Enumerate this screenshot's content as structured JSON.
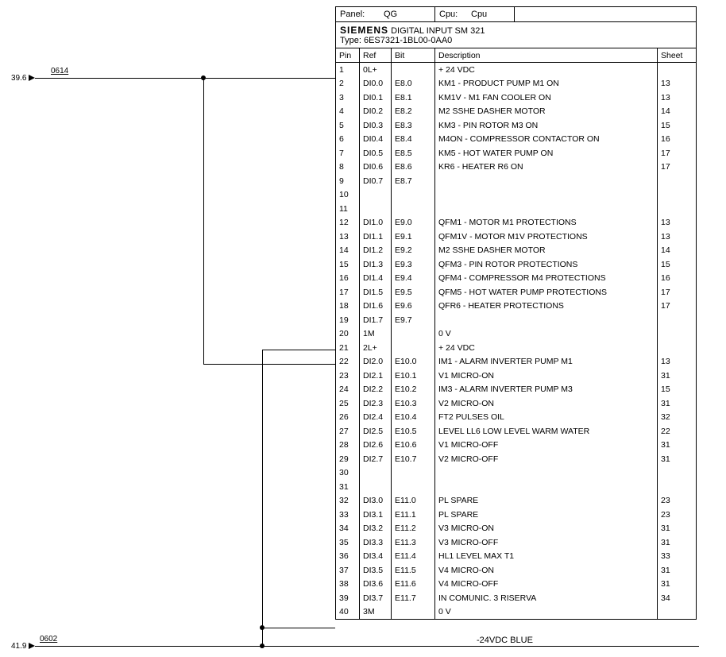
{
  "header": {
    "panel_label": "Panel:",
    "panel_value": "QG",
    "cpu_label": "Cpu:",
    "cpu_value": "Cpu",
    "brand": "SIEMENS",
    "title": "DIGITAL INPUT SM 321",
    "type_label": "Type:",
    "type_value": "6ES7321-1BL00-0AA0"
  },
  "columns": {
    "pin": "Pin",
    "ref": "Ref",
    "bit": "Bit",
    "description": "Description",
    "sheet": "Sheet"
  },
  "rows": [
    {
      "pin": "1",
      "ref": "0L+",
      "bit": "",
      "desc": "+ 24 VDC",
      "sheet": ""
    },
    {
      "pin": "2",
      "ref": "DI0.0",
      "bit": "E8.0",
      "desc": "KM1 - PRODUCT PUMP M1 ON",
      "sheet": "13"
    },
    {
      "pin": "3",
      "ref": "DI0.1",
      "bit": "E8.1",
      "desc": "KM1V - M1 FAN COOLER ON",
      "sheet": "13"
    },
    {
      "pin": "4",
      "ref": "DI0.2",
      "bit": "E8.2",
      "desc": "M2 SSHE DASHER MOTOR",
      "sheet": "14"
    },
    {
      "pin": "5",
      "ref": "DI0.3",
      "bit": "E8.3",
      "desc": "KM3 - PIN ROTOR M3 ON",
      "sheet": "15"
    },
    {
      "pin": "6",
      "ref": "DI0.4",
      "bit": "E8.4",
      "desc": "M4ON - COMPRESSOR CONTACTOR ON",
      "sheet": "16"
    },
    {
      "pin": "7",
      "ref": "DI0.5",
      "bit": "E8.5",
      "desc": "KM5 - HOT WATER PUMP ON",
      "sheet": "17"
    },
    {
      "pin": "8",
      "ref": "DI0.6",
      "bit": "E8.6",
      "desc": "KR6 - HEATER R6 ON",
      "sheet": "17"
    },
    {
      "pin": "9",
      "ref": "DI0.7",
      "bit": "E8.7",
      "desc": "",
      "sheet": ""
    },
    {
      "pin": "10",
      "ref": "",
      "bit": "",
      "desc": "",
      "sheet": ""
    },
    {
      "pin": "11",
      "ref": "",
      "bit": "",
      "desc": "",
      "sheet": ""
    },
    {
      "pin": "12",
      "ref": "DI1.0",
      "bit": "E9.0",
      "desc": "QFM1 - MOTOR M1 PROTECTIONS",
      "sheet": "13"
    },
    {
      "pin": "13",
      "ref": "DI1.1",
      "bit": "E9.1",
      "desc": "QFM1V - MOTOR M1V PROTECTIONS",
      "sheet": "13"
    },
    {
      "pin": "14",
      "ref": "DI1.2",
      "bit": "E9.2",
      "desc": "M2 SSHE DASHER MOTOR",
      "sheet": "14"
    },
    {
      "pin": "15",
      "ref": "DI1.3",
      "bit": "E9.3",
      "desc": "QFM3 - PIN ROTOR PROTECTIONS",
      "sheet": "15"
    },
    {
      "pin": "16",
      "ref": "DI1.4",
      "bit": "E9.4",
      "desc": "QFM4 - COMPRESSOR M4 PROTECTIONS",
      "sheet": "16"
    },
    {
      "pin": "17",
      "ref": "DI1.5",
      "bit": "E9.5",
      "desc": "QFM5 - HOT WATER PUMP PROTECTIONS",
      "sheet": "17"
    },
    {
      "pin": "18",
      "ref": "DI1.6",
      "bit": "E9.6",
      "desc": "QFR6 - HEATER PROTECTIONS",
      "sheet": "17"
    },
    {
      "pin": "19",
      "ref": "DI1.7",
      "bit": "E9.7",
      "desc": "",
      "sheet": ""
    },
    {
      "pin": "20",
      "ref": "1M",
      "bit": "",
      "desc": "0 V",
      "sheet": ""
    },
    {
      "pin": "21",
      "ref": "2L+",
      "bit": "",
      "desc": "+ 24 VDC",
      "sheet": ""
    },
    {
      "pin": "22",
      "ref": "DI2.0",
      "bit": "E10.0",
      "desc": "IM1 - ALARM INVERTER PUMP M1",
      "sheet": "13"
    },
    {
      "pin": "23",
      "ref": "DI2.1",
      "bit": "E10.1",
      "desc": "V1 MICRO-ON",
      "sheet": "31"
    },
    {
      "pin": "24",
      "ref": "DI2.2",
      "bit": "E10.2",
      "desc": "IM3 - ALARM INVERTER PUMP M3",
      "sheet": "15"
    },
    {
      "pin": "25",
      "ref": "DI2.3",
      "bit": "E10.3",
      "desc": "V2 MICRO-ON",
      "sheet": "31"
    },
    {
      "pin": "26",
      "ref": "DI2.4",
      "bit": "E10.4",
      "desc": "FT2 PULSES OIL",
      "sheet": "32"
    },
    {
      "pin": "27",
      "ref": "DI2.5",
      "bit": "E10.5",
      "desc": "LEVEL LL6 LOW LEVEL WARM WATER",
      "sheet": "22"
    },
    {
      "pin": "28",
      "ref": "DI2.6",
      "bit": "E10.6",
      "desc": "V1 MICRO-OFF",
      "sheet": "31"
    },
    {
      "pin": "29",
      "ref": "DI2.7",
      "bit": "E10.7",
      "desc": "V2 MICRO-OFF",
      "sheet": "31"
    },
    {
      "pin": "30",
      "ref": "",
      "bit": "",
      "desc": "",
      "sheet": ""
    },
    {
      "pin": "31",
      "ref": "",
      "bit": "",
      "desc": "",
      "sheet": ""
    },
    {
      "pin": "32",
      "ref": "DI3.0",
      "bit": "E11.0",
      "desc": "PL SPARE",
      "sheet": "23"
    },
    {
      "pin": "33",
      "ref": "DI3.1",
      "bit": "E11.1",
      "desc": "PL SPARE",
      "sheet": "23"
    },
    {
      "pin": "34",
      "ref": "DI3.2",
      "bit": "E11.2",
      "desc": "V3 MICRO-ON",
      "sheet": "31"
    },
    {
      "pin": "35",
      "ref": "DI3.3",
      "bit": "E11.3",
      "desc": "V3 MICRO-OFF",
      "sheet": "31"
    },
    {
      "pin": "36",
      "ref": "DI3.4",
      "bit": "E11.4",
      "desc": "HL1 LEVEL MAX T1",
      "sheet": "33"
    },
    {
      "pin": "37",
      "ref": "DI3.5",
      "bit": "E11.5",
      "desc": "V4 MICRO-ON",
      "sheet": "31"
    },
    {
      "pin": "38",
      "ref": "DI3.6",
      "bit": "E11.6",
      "desc": "V4 MICRO-OFF",
      "sheet": "31"
    },
    {
      "pin": "39",
      "ref": "DI3.7",
      "bit": "E11.7",
      "desc": "IN COMUNIC. 3 RISERVA",
      "sheet": "34"
    },
    {
      "pin": "40",
      "ref": "3M",
      "bit": "",
      "desc": "0 V",
      "sheet": ""
    }
  ],
  "wires": {
    "top_left_source": "39.6",
    "top_left_net": "0614",
    "bottom_left_source": "41.9",
    "bottom_left_net": "0602",
    "bottom_right_label": "-24VDC  BLUE"
  }
}
